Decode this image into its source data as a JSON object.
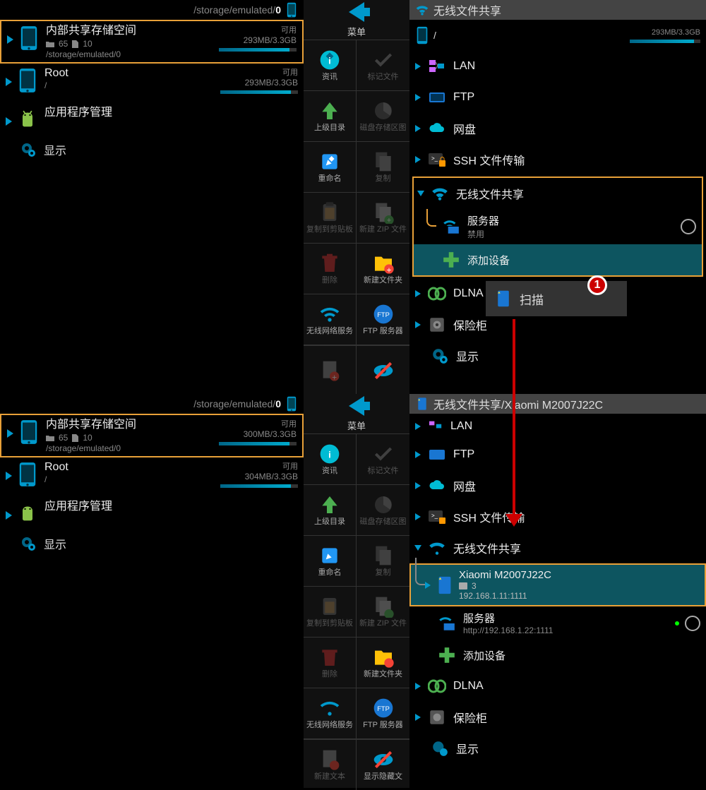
{
  "top_left": {
    "path": "/storage/emulated/0",
    "storage1": {
      "name": "内部共享存储空间",
      "folders": "65",
      "files": "10",
      "subpath": "/storage/emulated/0",
      "avail_label": "可用",
      "space": "293MB/3.3GB",
      "pct": 91
    },
    "storage2": {
      "name": "Root",
      "subpath": "/",
      "avail_label": "可用",
      "space": "293MB/3.3GB",
      "pct": 91
    },
    "app_manage": "应用程序管理",
    "display": "显示"
  },
  "bot_left": {
    "path": "/storage/emulated/0",
    "storage1": {
      "name": "内部共享存储空间",
      "folders": "65",
      "files": "10",
      "subpath": "/storage/emulated/0",
      "avail_label": "可用",
      "space": "300MB/3.3GB",
      "pct": 91
    },
    "storage2": {
      "name": "Root",
      "subpath": "/",
      "avail_label": "可用",
      "space": "304MB/3.3GB",
      "pct": 91
    },
    "app_manage": "应用程序管理",
    "display": "显示"
  },
  "menu": {
    "label": "菜单",
    "items": [
      {
        "label": "资讯",
        "enabled": true
      },
      {
        "label": "标记文件",
        "enabled": false
      },
      {
        "label": "上级目录",
        "enabled": true
      },
      {
        "label": "磁盘存储区图",
        "enabled": false
      },
      {
        "label": "重命名",
        "enabled": true
      },
      {
        "label": "复制",
        "enabled": false
      },
      {
        "label": "复制到剪贴板",
        "enabled": false
      },
      {
        "label": "新建 ZIP 文件",
        "enabled": false
      },
      {
        "label": "删除",
        "enabled": false
      },
      {
        "label": "新建文件夹",
        "enabled": true
      },
      {
        "label": "无线网络服务",
        "enabled": true
      },
      {
        "label": "FTP 服务器",
        "enabled": true
      }
    ],
    "extra1": {
      "label": "新建文本",
      "enabled": false
    },
    "extra2": {
      "label": "显示隐藏文",
      "enabled": true
    }
  },
  "top_right": {
    "header": "无线文件共享",
    "storage": {
      "path": "/",
      "space": "293MB/3.3GB",
      "pct": 91
    },
    "items": {
      "lan": "LAN",
      "ftp": "FTP",
      "cloud": "网盘",
      "ssh": "SSH 文件传输",
      "wifi": "无线文件共享",
      "server": "服务器",
      "server_status": "禁用",
      "add_dev": "添加设备",
      "dlna": "DLNA",
      "vault": "保险柜",
      "display": "显示"
    },
    "scan": "扫描",
    "badge": "1"
  },
  "bot_right": {
    "header": "无线文件共享/Xiaomi M2007J22C",
    "items": {
      "lan": "LAN",
      "ftp": "FTP",
      "cloud": "网盘",
      "ssh": "SSH 文件传输",
      "wifi": "无线文件共享",
      "xiaomi": "Xiaomi M2007J22C",
      "xiaomi_folders": "3",
      "xiaomi_ip": "192.168.1.11:1111",
      "server": "服务器",
      "server_url": "http://192.168.1.22:1111",
      "add_dev": "添加设备",
      "dlna": "DLNA",
      "vault": "保险柜",
      "display": "显示"
    }
  }
}
